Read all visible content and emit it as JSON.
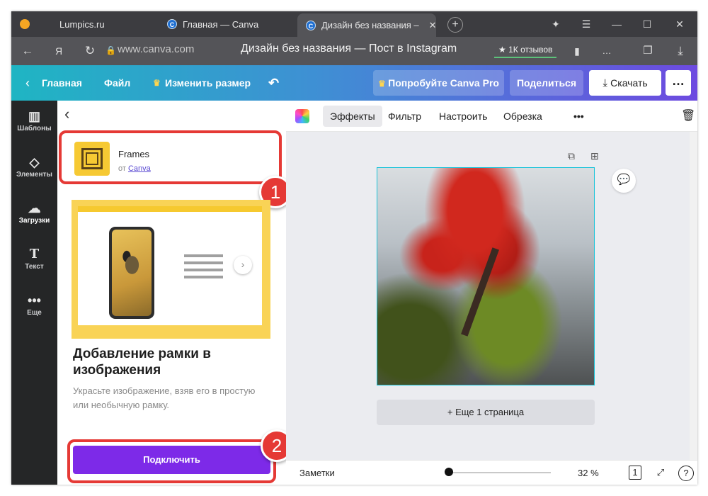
{
  "browser": {
    "tabs": [
      {
        "label": "Lumpics.ru"
      },
      {
        "label": "Главная — Canva"
      },
      {
        "label": "Дизайн без названия –"
      }
    ],
    "url": "www.canva.com",
    "page_title": "Дизайн без названия — Пост в Instagram",
    "reviews": "★ 1К отзывов"
  },
  "canva_top": {
    "home": "Главная",
    "file": "Файл",
    "resize": "Изменить размер",
    "try_pro": "Попробуйте Canva Pro",
    "share": "Поделиться",
    "download": "Скачать"
  },
  "rail": {
    "items": [
      {
        "label": "Шаблоны",
        "icon": "templates-icon"
      },
      {
        "label": "Элементы",
        "icon": "elements-icon"
      },
      {
        "label": "Загрузки",
        "icon": "uploads-icon"
      },
      {
        "label": "Текст",
        "icon": "text-icon"
      },
      {
        "label": "Еще",
        "icon": "more-icon"
      }
    ]
  },
  "panel": {
    "app_name": "Frames",
    "app_by_prefix": "от",
    "app_by_link": "Canva",
    "badge_1": "1",
    "badge_2": "2",
    "heading": "Добавление рамки в изображения",
    "description": "Украсьте изображение, взяв его в простую или необычную рамку.",
    "connect": "Подключить"
  },
  "editor": {
    "tools": [
      "Эффекты",
      "Фильтр",
      "Настроить",
      "Обрезка"
    ],
    "add_page": "+ Еще 1 страница"
  },
  "bottom": {
    "notes": "Заметки",
    "zoom": "32 %",
    "zoom_fraction": 0.0,
    "page_count": "1",
    "help": "?"
  },
  "colors": {
    "accent_purple": "#7d2ae8",
    "highlight_red": "#e53935",
    "selection_cyan": "#17c3d9"
  }
}
